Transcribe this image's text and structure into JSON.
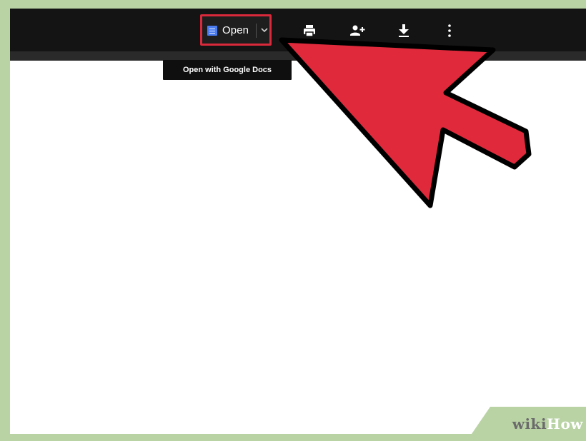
{
  "toolbar": {
    "open_label": "Open",
    "icons": [
      "docs-icon",
      "chevron-down-icon",
      "print-icon",
      "add-person-icon",
      "download-icon",
      "more-vert-icon"
    ]
  },
  "tooltip": {
    "text": "Open with Google Docs"
  },
  "watermark": {
    "part1": "wiki",
    "part2": "How"
  },
  "colors": {
    "highlight_red": "#d9293a",
    "arrow_red": "#e02a3c",
    "frame_green": "#b9d3a4",
    "toolbar_bg": "#141414",
    "docs_blue": "#4a7cf0"
  }
}
